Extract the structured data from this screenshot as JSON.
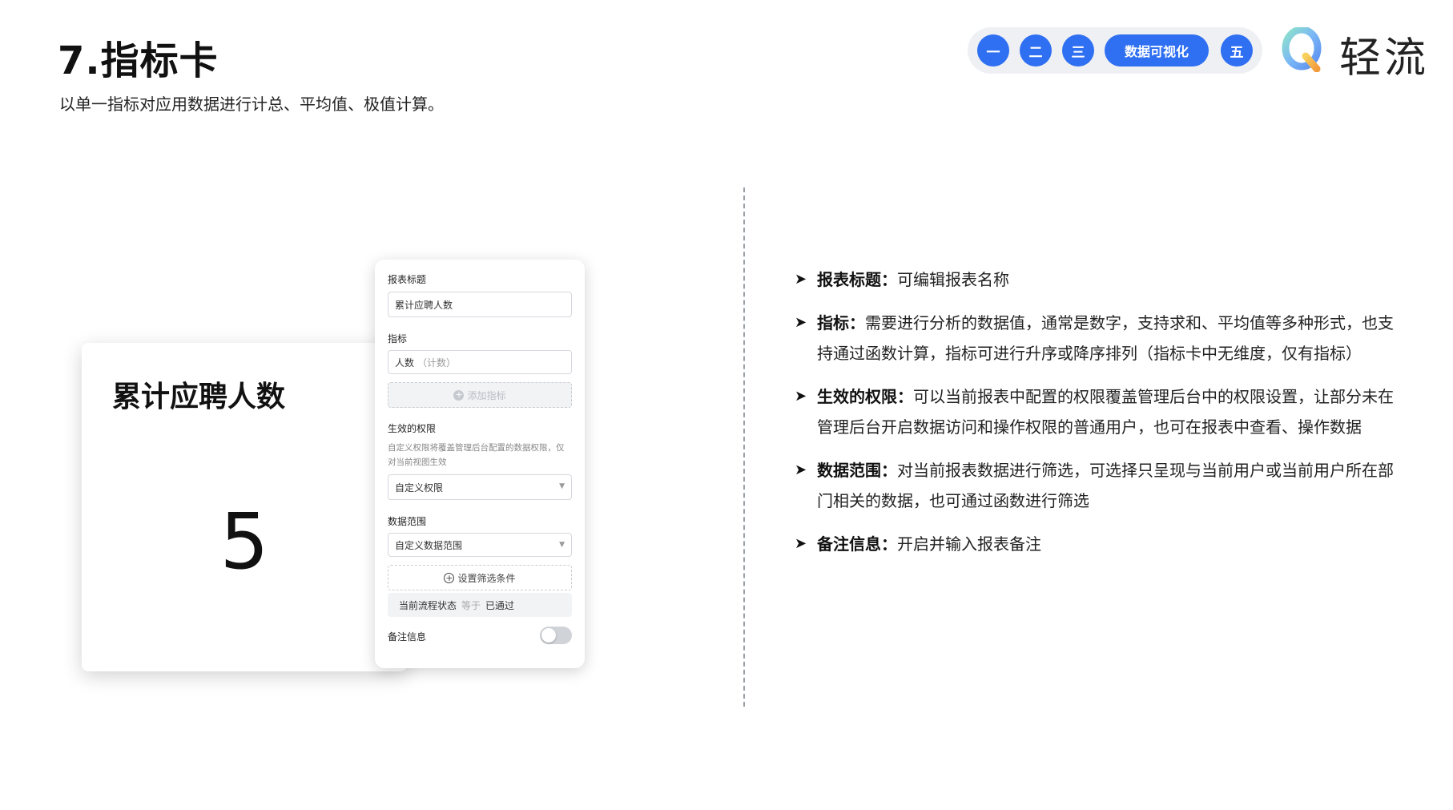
{
  "header": {
    "title": "7.指标卡",
    "subtitle": "以单一指标对应用数据进行计总、平均值、极值计算。"
  },
  "nav": {
    "items": [
      "一",
      "二",
      "三",
      "数据可视化",
      "五"
    ],
    "active_color": "#2f6ff2"
  },
  "brand": {
    "name": "轻流",
    "logo_icon": "brand-logo-icon"
  },
  "metric_card": {
    "title": "累计应聘人数",
    "value": "5"
  },
  "panel": {
    "report_title_label": "报表标题",
    "report_title_value": "累计应聘人数",
    "metric_label": "指标",
    "metric_value": "人数",
    "metric_agg": "（计数）",
    "add_metric": "添加指标",
    "permission_label": "生效的权限",
    "permission_help": "自定义权限将覆盖管理后台配置的数据权限，仅对当前视图生效",
    "permission_value": "自定义权限",
    "range_label": "数据范围",
    "range_value": "自定义数据范围",
    "set_filter": "设置筛选条件",
    "condition_field": "当前流程状态",
    "condition_op": "等于",
    "condition_value": "已通过",
    "notes_label": "备注信息",
    "notes_enabled": false
  },
  "descriptions": [
    {
      "term": "报表标题：",
      "text": "可编辑报表名称"
    },
    {
      "term": "指标：",
      "text": "需要进行分析的数据值，通常是数字，支持求和、平均值等多种形式，也支持通过函数计算，指标可进行升序或降序排列（指标卡中无维度，仅有指标）"
    },
    {
      "term": "生效的权限：",
      "text": "可以当前报表中配置的权限覆盖管理后台中的权限设置，让部分未在管理后台开启数据访问和操作权限的普通用户，也可在报表中查看、操作数据"
    },
    {
      "term": "数据范围：",
      "text": "对当前报表数据进行筛选，可选择只呈现与当前用户或当前用户所在部门相关的数据，也可通过函数进行筛选"
    },
    {
      "term": "备注信息：",
      "text": "开启并输入报表备注"
    }
  ]
}
